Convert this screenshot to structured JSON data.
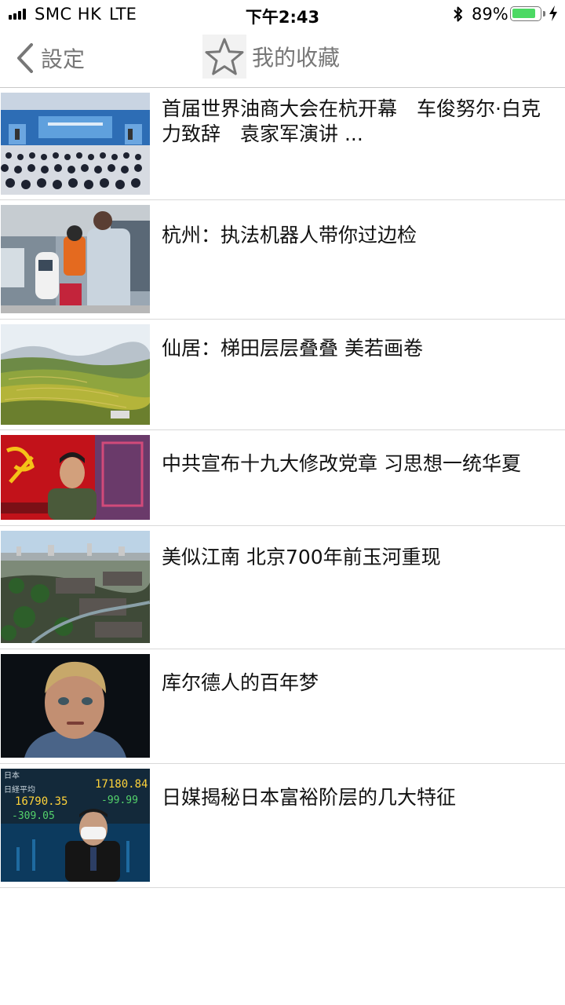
{
  "status_bar": {
    "carrier": "SMC HK",
    "network": "LTE",
    "time": "下午2:43",
    "battery_percent": "89%",
    "battery_level": 0.89,
    "icons": [
      "signal-icon",
      "bluetooth-icon",
      "battery-icon",
      "charging-icon"
    ]
  },
  "nav": {
    "back_label": "設定",
    "title": "我的收藏",
    "icons": [
      "chevron-left-icon",
      "star-icon"
    ]
  },
  "favorites": [
    {
      "title": "首届世界油商大会在杭开幕　车俊努尔·白克力致辞　袁家军演讲 ...",
      "thumbnail": "conference-hall-photo"
    },
    {
      "title": "杭州：执法机器人带你过边检",
      "thumbnail": "robot-border-check-photo"
    },
    {
      "title": "仙居：梯田层层叠叠 美若画卷",
      "thumbnail": "terraced-fields-photo"
    },
    {
      "title": "中共宣布十九大修改党章 习思想一统华夏",
      "thumbnail": "party-flag-portrait-photo"
    },
    {
      "title": "美似江南 北京700年前玉河重现",
      "thumbnail": "beijing-river-aerial-photo"
    },
    {
      "title": "库尔德人的百年梦",
      "thumbnail": "kurdish-boy-portrait-photo"
    },
    {
      "title": "日媒揭秘日本富裕阶层的几大特征",
      "thumbnail": "stock-board-man-photo"
    }
  ],
  "colors": {
    "nav_gray": "#777777",
    "battery_green": "#4cd964",
    "divider": "#d9d9d9"
  }
}
